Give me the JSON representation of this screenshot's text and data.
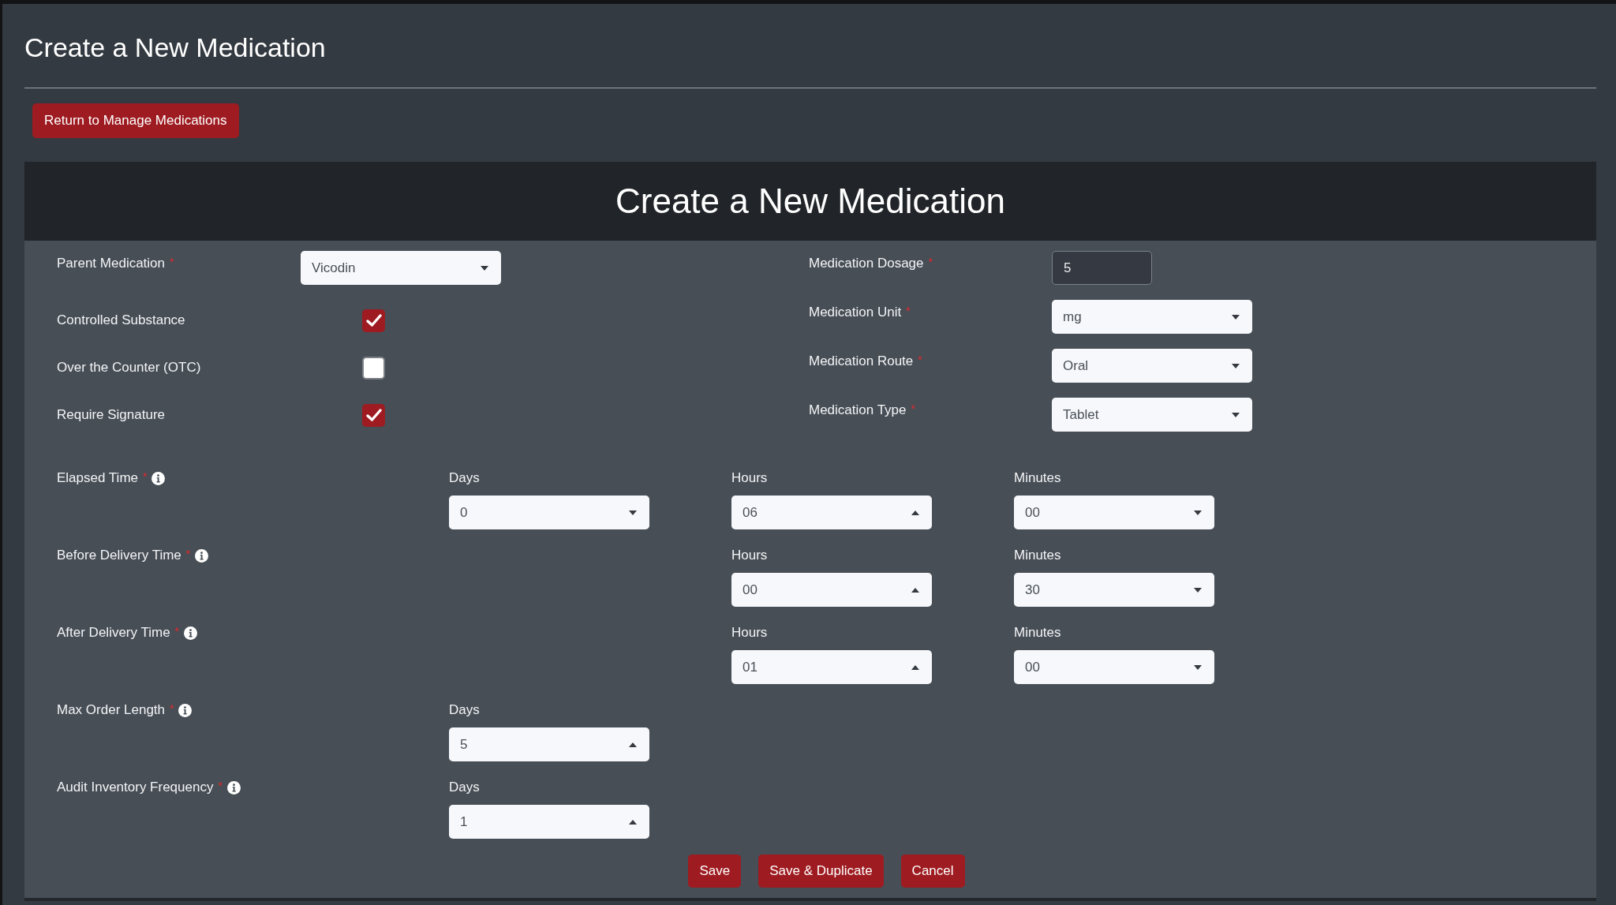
{
  "page": {
    "title": "Create a New Medication",
    "back_button": "Return to Manage Medications"
  },
  "card": {
    "title": "Create a New Medication"
  },
  "left_fields": [
    {
      "kind": "select",
      "label": "Parent Medication",
      "required_mark": "*",
      "value": "Vicodin",
      "opens_up": false
    },
    {
      "kind": "checkbox",
      "label": "Controlled Substance",
      "checked": true
    },
    {
      "kind": "checkbox",
      "label": "Over the Counter (OTC)",
      "checked": false
    },
    {
      "kind": "checkbox",
      "label": "Require Signature",
      "checked": true
    }
  ],
  "right_fields": [
    {
      "kind": "input",
      "label": "Medication Dosage",
      "required_mark": "*",
      "value": "5"
    },
    {
      "kind": "select",
      "label": "Medication Unit",
      "required_mark": "*",
      "value": "mg",
      "opens_up": false
    },
    {
      "kind": "select",
      "label": "Medication Route",
      "required_mark": "*",
      "value": "Oral",
      "opens_up": false
    },
    {
      "kind": "select",
      "label": "Medication Type",
      "required_mark": "*",
      "value": "Tablet",
      "opens_up": false
    }
  ],
  "time_rows": [
    {
      "label": "Elapsed Time",
      "required_mark": "*",
      "info": true,
      "parts": [
        {
          "kind": "days",
          "label": "Days",
          "value": "0",
          "opens_up": false
        },
        {
          "kind": "hours",
          "label": "Hours",
          "value": "06",
          "opens_up": true
        },
        {
          "kind": "minutes",
          "label": "Minutes",
          "value": "00",
          "opens_up": false
        }
      ]
    },
    {
      "label": "Before Delivery Time",
      "required_mark": "*",
      "info": true,
      "parts": [
        {
          "kind": "hours",
          "label": "Hours",
          "value": "00",
          "opens_up": true
        },
        {
          "kind": "minutes",
          "label": "Minutes",
          "value": "30",
          "opens_up": false
        }
      ]
    },
    {
      "label": "After Delivery Time",
      "required_mark": "*",
      "info": true,
      "parts": [
        {
          "kind": "hours",
          "label": "Hours",
          "value": "01",
          "opens_up": true
        },
        {
          "kind": "minutes",
          "label": "Minutes",
          "value": "00",
          "opens_up": false
        }
      ]
    },
    {
      "label": "Max Order Length",
      "required_mark": "*",
      "info": true,
      "parts": [
        {
          "kind": "days",
          "label": "Days",
          "value": "5",
          "opens_up": true
        }
      ]
    },
    {
      "label": "Audit Inventory Frequency",
      "required_mark": "*",
      "info": true,
      "parts": [
        {
          "kind": "days",
          "label": "Days",
          "value": "1",
          "opens_up": true
        }
      ]
    }
  ],
  "buttons": [
    "Save",
    "Save & Duplicate",
    "Cancel"
  ]
}
